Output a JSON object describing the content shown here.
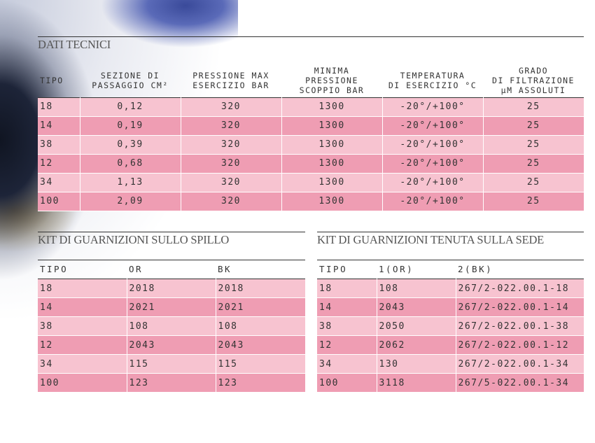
{
  "dati": {
    "title": "DATI TECNICI",
    "headers": [
      [
        "TIPO"
      ],
      [
        "SEZIONE DI",
        "PASSAGGIO CM²"
      ],
      [
        "PRESSIONE MAX",
        "ESERCIZIO BAR"
      ],
      [
        "MINIMA",
        "PRESSIONE",
        "SCOPPIO BAR"
      ],
      [
        "TEMPERATURA",
        "DI ESERCIZIO °C"
      ],
      [
        "GRADO",
        "DI FILTRAZIONE",
        "µM ASSOLUTI"
      ]
    ],
    "rows": [
      [
        "18",
        "0,12",
        "320",
        "1300",
        "-20°/+100°",
        "25"
      ],
      [
        "14",
        "0,19",
        "320",
        "1300",
        "-20°/+100°",
        "25"
      ],
      [
        "38",
        "0,39",
        "320",
        "1300",
        "-20°/+100°",
        "25"
      ],
      [
        "12",
        "0,68",
        "320",
        "1300",
        "-20°/+100°",
        "25"
      ],
      [
        "34",
        "1,13",
        "320",
        "1300",
        "-20°/+100°",
        "25"
      ],
      [
        "100",
        "2,09",
        "320",
        "1300",
        "-20°/+100°",
        "25"
      ]
    ]
  },
  "kit_spillo": {
    "title": "KIT DI GUARNIZIONI SULLO SPILLO",
    "headers": [
      "TIPO",
      "OR",
      "BK"
    ],
    "rows": [
      [
        "18",
        "2018",
        "2018"
      ],
      [
        "14",
        "2021",
        "2021"
      ],
      [
        "38",
        "108",
        "108"
      ],
      [
        "12",
        "2043",
        "2043"
      ],
      [
        "34",
        "115",
        "115"
      ],
      [
        "100",
        "123",
        "123"
      ]
    ]
  },
  "kit_sede": {
    "title": "KIT DI GUARNIZIONI TENUTA SULLA SEDE",
    "headers": [
      "TIPO",
      "1(OR)",
      "2(BK)"
    ],
    "rows": [
      [
        "18",
        "108",
        "267/2-022.00.1-18"
      ],
      [
        "14",
        "2043",
        "267/2-022.00.1-14"
      ],
      [
        "38",
        "2050",
        "267/2-022.00.1-38"
      ],
      [
        "12",
        "2062",
        "267/2-022.00.1-12"
      ],
      [
        "34",
        "130",
        "267/2-022.00.1-34"
      ],
      [
        "100",
        "3118",
        "267/5-022.00.1-34"
      ]
    ]
  }
}
